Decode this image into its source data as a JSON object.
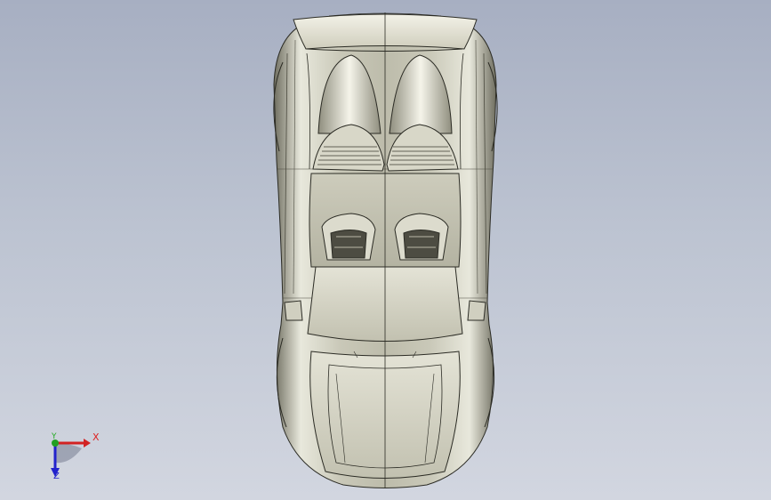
{
  "viewport": {
    "background_top": "#a7afc2",
    "background_bottom": "#d2d6e0"
  },
  "model": {
    "name_icon": "car-model-top-view",
    "body_color": "#d9d9cf",
    "edge_color": "#2b2b24"
  },
  "triad": {
    "x_label": "X",
    "y_label": "Y",
    "z_label": "Z",
    "x_color": "#d22222",
    "y_color": "#22a022",
    "z_color": "#2222cc"
  }
}
